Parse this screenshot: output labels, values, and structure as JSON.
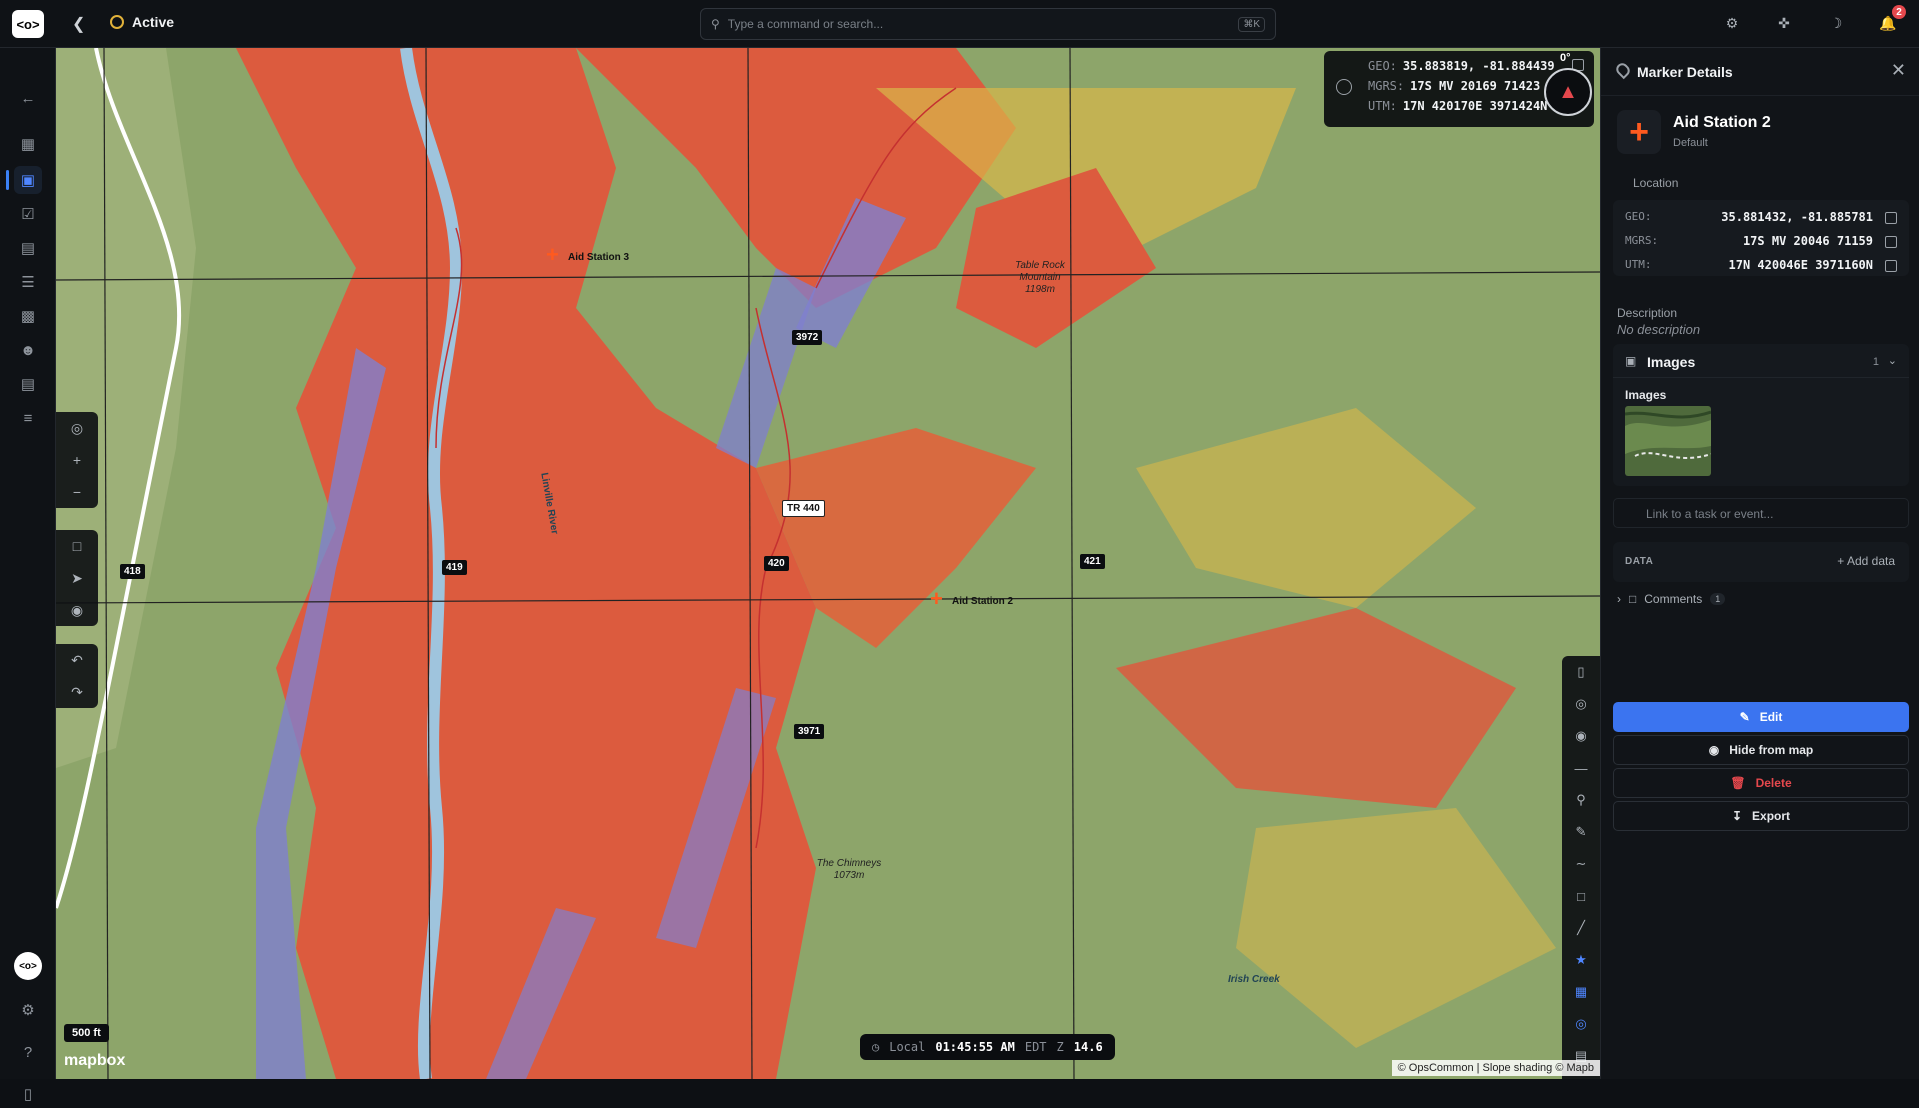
{
  "topbar": {
    "logo": "<o>",
    "status": "Active",
    "search_placeholder": "Type a command or search...",
    "search_shortcut": "⌘K",
    "notification_count": "2"
  },
  "rail": {
    "items": [
      "collapse",
      "dashboard",
      "map",
      "tasks",
      "calendar",
      "list",
      "analytics",
      "people",
      "clipboard",
      "settings-sliders"
    ],
    "avatar": "<o>"
  },
  "map": {
    "coords": {
      "geo_label": "GEO:",
      "geo": "35.883819, -81.884439",
      "mgrs_label": "MGRS:",
      "mgrs": "17S MV 20169 71423",
      "utm_label": "UTM:",
      "utm": "17N 420170E 3971424N"
    },
    "compass_deg": "0°",
    "grid_labels": [
      "3972",
      "418",
      "419",
      "420",
      "421",
      "3971"
    ],
    "road_label": "TR 440",
    "markers": [
      "Aid Station 3",
      "Aid Station 2"
    ],
    "peaks": [
      {
        "name": "Table Rock Mountain",
        "elev": "1198m"
      },
      {
        "name": "The Chimneys",
        "elev": "1073m"
      }
    ],
    "river_label": "Linville River",
    "creek_label": "Irish Creek",
    "scale": "500 ft",
    "brand": "mapbox",
    "attribution": "© OpsCommon | Slope shading © Mapb",
    "clock": {
      "label": "Local",
      "time": "01:45:55 AM",
      "tz": "EDT",
      "zoom_label": "Z",
      "zoom": "14.6"
    }
  },
  "panel": {
    "title": "Marker Details",
    "marker_name": "Aid Station 2",
    "marker_style": "Default",
    "location_label": "Location",
    "geo_label": "GEO:",
    "geo": "35.881432, -81.885781",
    "mgrs_label": "MGRS:",
    "mgrs": "17S MV 20046 71159",
    "utm_label": "UTM:",
    "utm": "17N 420046E 3971160N",
    "description_label": "Description",
    "description": "No description",
    "images_title": "Images",
    "images_count": "1",
    "images_sub": "Images",
    "link_placeholder": "Link to a task or event...",
    "data_label": "DATA",
    "add_data": "Add data",
    "comments_label": "Comments",
    "comments_count": "1",
    "edit": "Edit",
    "hide": "Hide from map",
    "delete": "Delete",
    "export": "Export"
  },
  "colors": {
    "accent": "#3b74f0",
    "marker": "#ff5a1f",
    "slope_high": "#e2593f",
    "slope_mid": "#d9b84a",
    "slope_low": "#8da56a",
    "steep": "#7f7fd0"
  }
}
